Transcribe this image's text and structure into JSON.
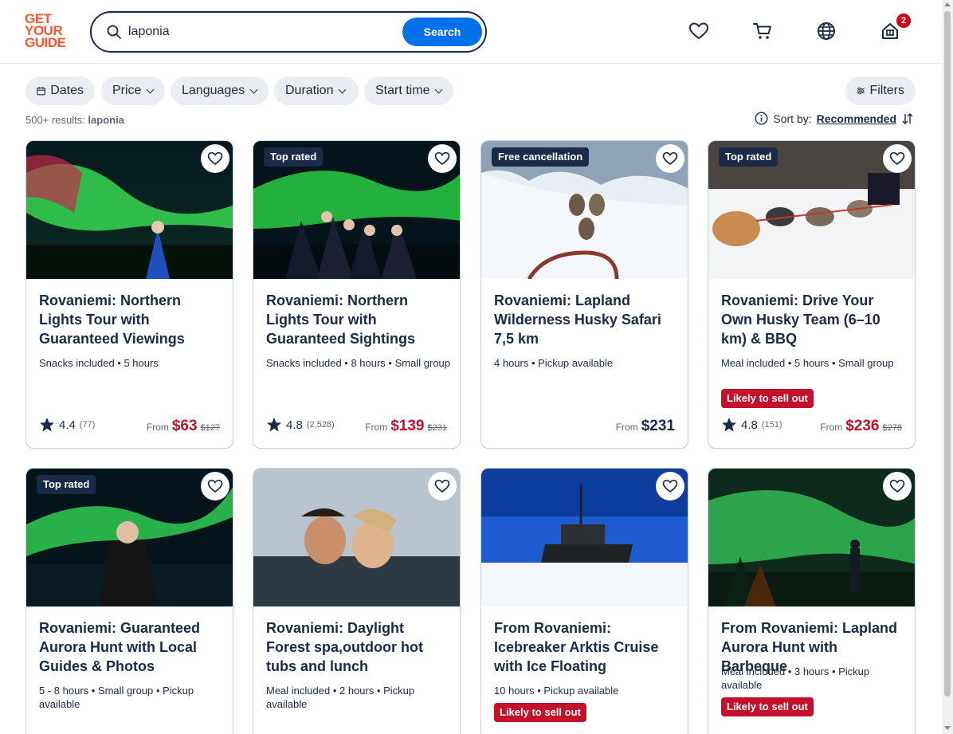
{
  "header": {
    "logo": [
      "GET",
      "YOUR",
      "GUIDE"
    ],
    "search_value": "laponia",
    "search_button": "Search",
    "notification_count": "2"
  },
  "filters": {
    "dates": "Dates",
    "price": "Price",
    "languages": "Languages",
    "duration": "Duration",
    "start_time": "Start time",
    "filters": "Filters"
  },
  "results": {
    "count": "500+ results:",
    "query": "laponia",
    "sort_label": "Sort by:",
    "sort_value": "Recommended"
  },
  "colors": {
    "brand": "#ff5533",
    "primary": "#0071eb",
    "text": "#1a2b49",
    "discount": "#c4102b"
  },
  "cards": [
    {
      "tag": "",
      "title": "Rovaniemi: Northern Lights Tour with Guaranteed Viewings",
      "meta": "Snacks included • 5 hours",
      "sellout": "",
      "rating": "4.4",
      "reviews": "(77)",
      "from": "From",
      "price": "$63",
      "old_price": "$127"
    },
    {
      "tag": "Top rated",
      "title": "Rovaniemi: Northern Lights Tour with Guaranteed Sightings",
      "meta": "Snacks included • 8 hours • Small group",
      "sellout": "",
      "rating": "4.8",
      "reviews": "(2,528)",
      "from": "From",
      "price": "$139",
      "old_price": "$231"
    },
    {
      "tag": "Free cancellation",
      "title": "Rovaniemi: Lapland Wilderness Husky Safari 7,5 km",
      "meta": "4 hours • Pickup available",
      "sellout": "",
      "rating": "",
      "reviews": "",
      "from": "From",
      "price": "$231",
      "old_price": ""
    },
    {
      "tag": "Top rated",
      "title": "Rovaniemi: Drive Your Own Husky Team (6–10 km) & BBQ",
      "meta": "Meal included • 5 hours • Small group",
      "sellout": "Likely to sell out",
      "rating": "4.8",
      "reviews": "(151)",
      "from": "From",
      "price": "$236",
      "old_price": "$278"
    },
    {
      "tag": "Top rated",
      "title": "Rovaniemi: Guaranteed Aurora Hunt with Local Guides & Photos",
      "meta": "5 - 8 hours • Small group • Pickup available",
      "sellout": ""
    },
    {
      "tag": "",
      "title": "Rovaniemi: Daylight Forest spa,outdoor hot tubs and lunch",
      "meta": "Meal included • 2 hours • Pickup available",
      "sellout": ""
    },
    {
      "tag": "",
      "title": "From Rovaniemi: Icebreaker Arktis Cruise with Ice Floating",
      "meta": "10 hours • Pickup available",
      "sellout": "Likely to sell out"
    },
    {
      "tag": "",
      "title": "From Rovaniemi: Lapland Aurora Hunt with Barbeque",
      "meta": "Meal included • 3 hours • Pickup available",
      "sellout": "Likely to sell out"
    }
  ]
}
